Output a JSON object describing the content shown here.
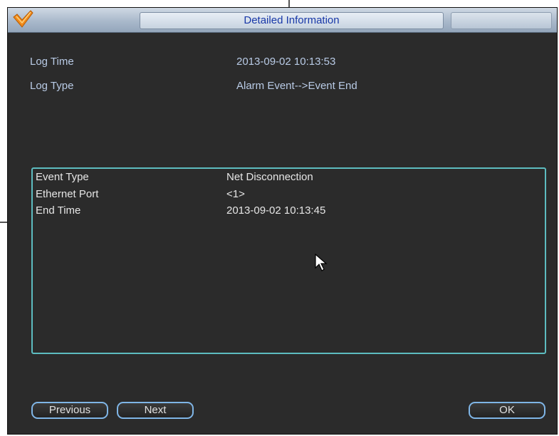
{
  "window": {
    "title": "Detailed Information"
  },
  "info": [
    {
      "label": "Log Time",
      "value": "2013-09-02 10:13:53"
    },
    {
      "label": "Log Type",
      "value": "Alarm Event-->Event End"
    }
  ],
  "details": [
    {
      "label": "Event Type",
      "value": "Net Disconnection"
    },
    {
      "label": "Ethernet Port",
      "value": "<1>"
    },
    {
      "label": "End Time",
      "value": "2013-09-02 10:13:45"
    }
  ],
  "buttons": {
    "previous": "Previous",
    "next": "Next",
    "ok": "OK"
  },
  "icons": {
    "logo": "checkmark-logo-icon",
    "cursor": "mouse-pointer-icon"
  },
  "colors": {
    "title_text": "#1838a8",
    "info_text": "#b9cbe6",
    "detail_border": "#5dbcc0",
    "button_border": "#7fb5e6",
    "background": "#2b2b2b"
  }
}
